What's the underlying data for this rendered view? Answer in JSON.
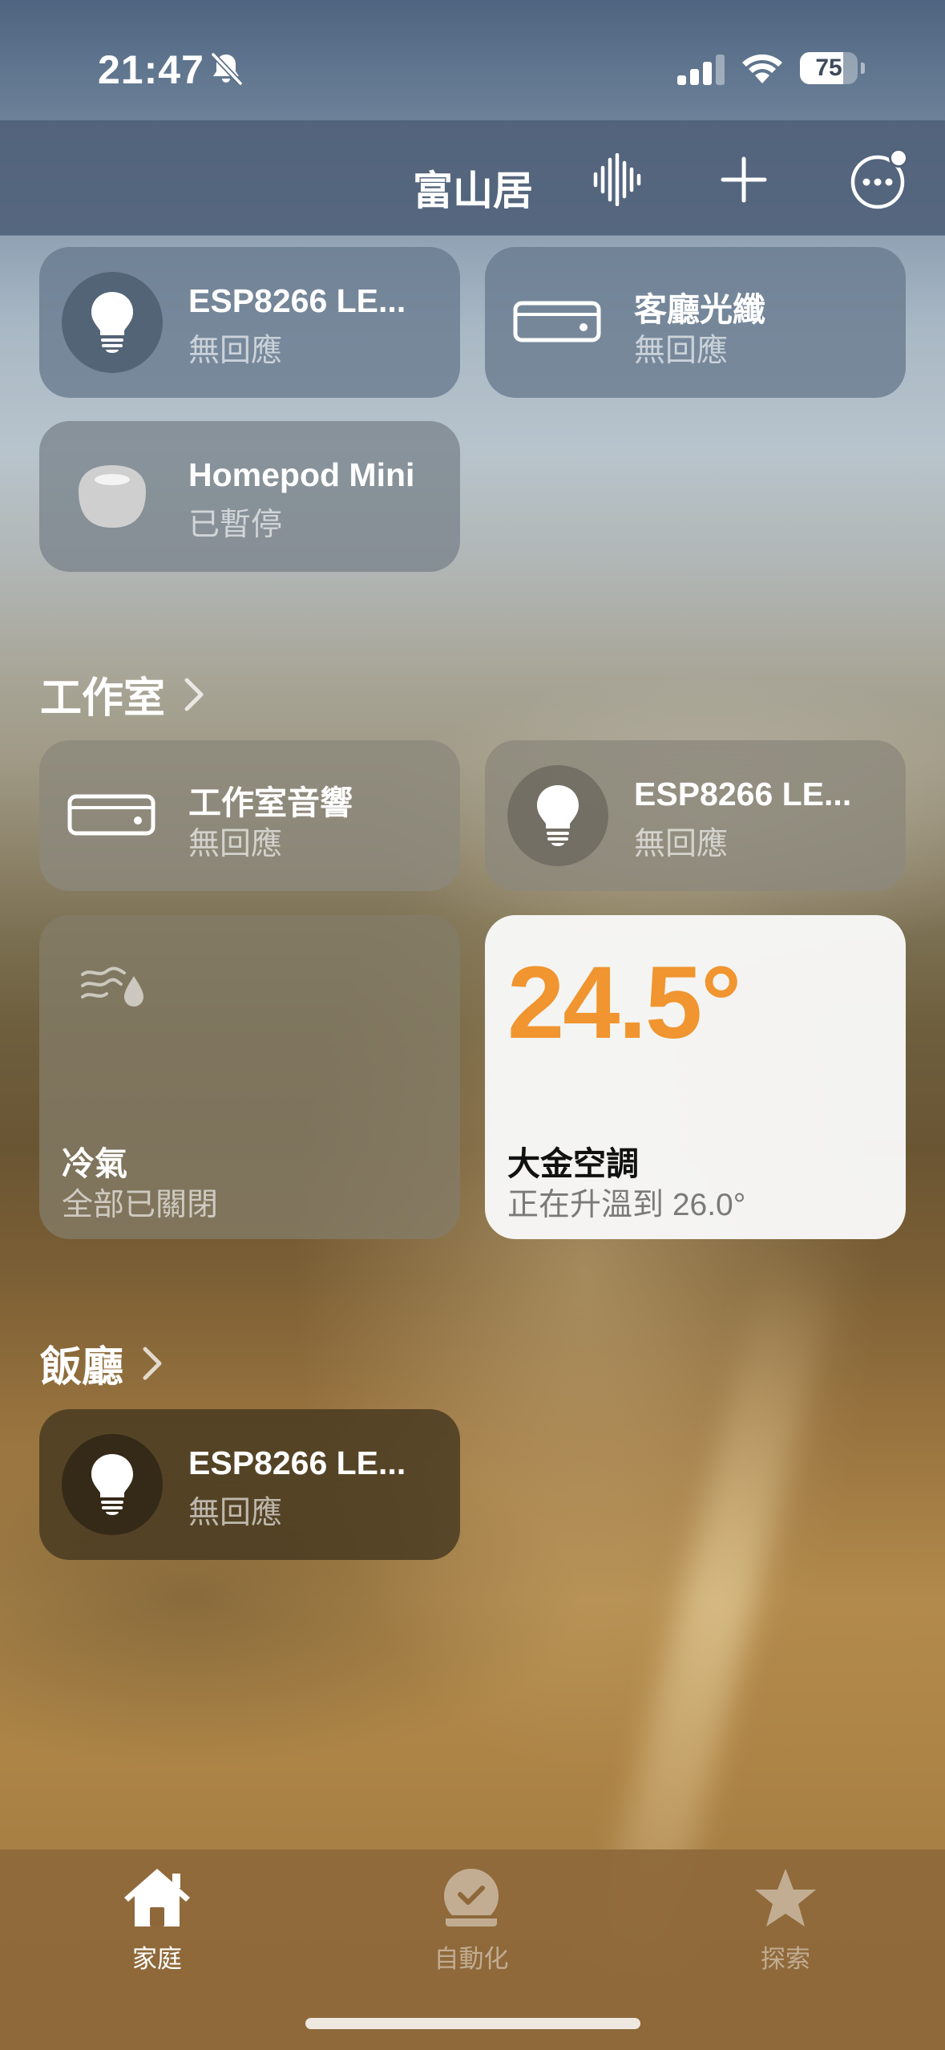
{
  "status_bar": {
    "time": "21:47",
    "battery_percent": "75",
    "battery_level": 0.75
  },
  "header": {
    "home_name": "富山居",
    "buttons": [
      "voice-intercom",
      "add",
      "more"
    ]
  },
  "tiles_top": [
    {
      "name": "ESP8266 LE...",
      "status": "無回應",
      "icon": "lightbulb-icon"
    },
    {
      "name": "客廳光纖",
      "status": "無回應",
      "icon": "hub-box-icon"
    },
    {
      "name": "Homepod Mini",
      "status": "已暫停",
      "icon": "homepod-mini-icon"
    }
  ],
  "sections": {
    "studio": {
      "title": "工作室",
      "tiles": [
        {
          "name": "工作室音響",
          "status": "無回應",
          "icon": "hub-box-icon"
        },
        {
          "name": "ESP8266 LE...",
          "status": "無回應",
          "icon": "lightbulb-icon"
        }
      ],
      "ac_group": {
        "name": "冷氣",
        "status": "全部已關閉",
        "icon": "air-humidity-icon"
      },
      "thermostat": {
        "temperature": "24.5°",
        "name": "大金空調",
        "status": "正在升溫到 26.0°",
        "accent": "#f0952f"
      }
    },
    "dining": {
      "title": "飯廳",
      "tiles": [
        {
          "name": "ESP8266 LE...",
          "status": "無回應",
          "icon": "lightbulb-icon"
        }
      ]
    }
  },
  "tab_bar": {
    "tabs": [
      {
        "label": "家庭",
        "icon": "home-icon",
        "active": true
      },
      {
        "label": "自動化",
        "icon": "clock-check-icon",
        "active": false
      },
      {
        "label": "探索",
        "icon": "star-icon",
        "active": false
      }
    ]
  }
}
